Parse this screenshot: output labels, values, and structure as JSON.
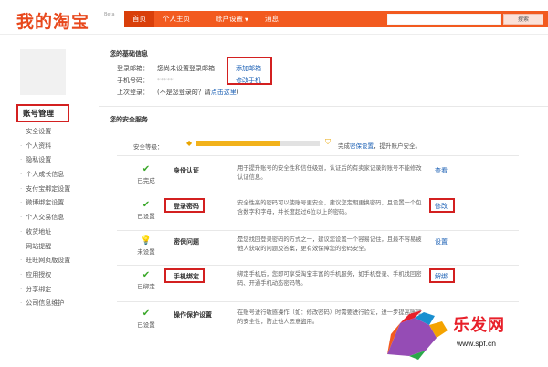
{
  "header": {
    "logo": "我的淘宝",
    "beta": "Beta",
    "nav": {
      "home": "首页",
      "personal": "个人主页",
      "settings": "账户设置",
      "messages": "消息"
    },
    "search_button": "搜索",
    "accent_color": "#f25a1f"
  },
  "sidebar": {
    "title": "账号管理",
    "items": [
      "安全设置",
      "个人资料",
      "隐私设置",
      "个人成长信息",
      "支付宝绑定设置",
      "微博绑定设置",
      "个人交易信息",
      "收货地址",
      "网站提醒",
      "旺旺网页版设置",
      "应用授权",
      "分享绑定",
      "公司信息维护"
    ]
  },
  "basic_info": {
    "title": "您的基础信息",
    "login_email_label": "登录邮箱：",
    "login_email_value": "您尚未设置登录邮箱",
    "login_email_action": "添加邮箱",
    "phone_label": "手机号码：",
    "phone_value": "*****",
    "phone_action": "修改手机",
    "last_login_label": "上次登录：",
    "last_login_value": "(不是您登录的？请",
    "last_login_action": "点击这里",
    "last_login_end": ")"
  },
  "security": {
    "title": "您的安全服务",
    "level_label": "安全等级：",
    "level_progress": 0.68,
    "level_text_prefix": "完成",
    "level_text_link": "密保设置",
    "level_text_suffix": "，提升账户安全。",
    "rows": [
      {
        "status": "已完成",
        "name": "身份认证",
        "desc": "用于提升账号的安全性和信任级别，认证后的有卖家记录的账号不能修改认证信息。",
        "action": "查看"
      },
      {
        "status": "已设置",
        "name": "登录密码",
        "desc": "安全性高的密码可以使账号更安全，建议您定期更换密码，且设置一个包含数字和字母，并长度超过6位以上的密码。",
        "action": "修改"
      },
      {
        "status": "未设置",
        "name": "密保问题",
        "desc": "是您找回登录密码的方式之一，建议您设置一个容易记住，且最不容易被他人获取的问题及答案，更有效保障您的密码安全。",
        "action": "设置"
      },
      {
        "status": "已绑定",
        "name": "手机绑定",
        "desc": "绑定手机后，您即可享受淘宝丰富的手机服务，如手机登录、手机找回密码、开通手机动态密码等。",
        "action": "解绑"
      },
      {
        "status": "已设置",
        "name": "操作保护设置",
        "desc": "在账号进行敏感操作（如：修改密码）时需要进行验证，进一步提高账号的安全性，防止他人恶意盗用。",
        "action": ""
      }
    ]
  },
  "watermark": {
    "brand": "乐发网",
    "url": "www.spf.cn"
  }
}
